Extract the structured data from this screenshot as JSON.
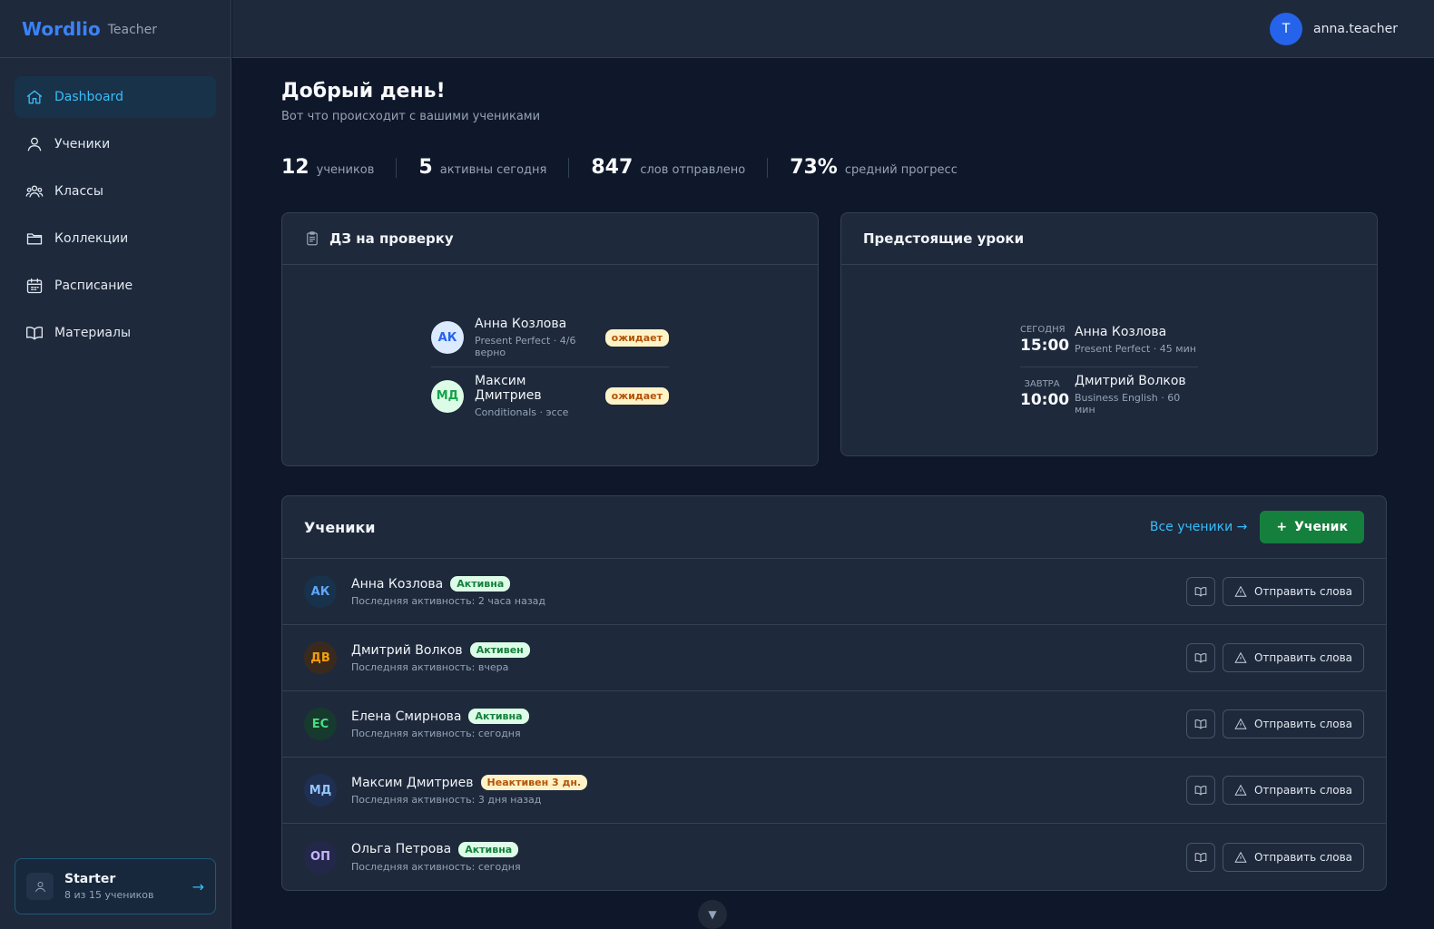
{
  "brand": {
    "name": "Wordlio",
    "role": "Teacher"
  },
  "nav": [
    {
      "label": "Dashboard",
      "icon": "home-icon"
    },
    {
      "label": "Ученики",
      "icon": "user-icon"
    },
    {
      "label": "Классы",
      "icon": "users-icon"
    },
    {
      "label": "Коллекции",
      "icon": "folder-icon"
    },
    {
      "label": "Расписание",
      "icon": "calendar-icon"
    },
    {
      "label": "Материалы",
      "icon": "book-icon"
    }
  ],
  "plan": {
    "title": "Starter",
    "sub": "8 из 15 учеников",
    "arrow": "→"
  },
  "user": {
    "initial": "T",
    "name": "anna.teacher"
  },
  "header": {
    "greeting": "Добрый день!",
    "subtitle": "Вот что происходит с вашими учениками"
  },
  "stats": [
    {
      "value": "12",
      "label": "учеников"
    },
    {
      "value": "5",
      "label": "активны сегодня"
    },
    {
      "value": "847",
      "label": "слов отправлено"
    },
    {
      "value": "73%",
      "label": "средний прогресс"
    }
  ],
  "homework": {
    "title": "ДЗ на проверку",
    "items": [
      {
        "initials": "АК",
        "name": "Анна Козлова",
        "meta": "Present Perfect · 4/6 верно",
        "badge": "ожидает"
      },
      {
        "initials": "МД",
        "name": "Максим Дмитриев",
        "meta": "Conditionals · эссе",
        "badge": "ожидает"
      }
    ]
  },
  "lessons": {
    "title": "Предстоящие уроки",
    "items": [
      {
        "day": "СЕГОДНЯ",
        "time": "15:00",
        "name": "Анна Козлова",
        "meta": "Present Perfect · 45 мин"
      },
      {
        "day": "ЗАВТРА",
        "time": "10:00",
        "name": "Дмитрий Волков",
        "meta": "Business English · 60 мин"
      }
    ]
  },
  "students": {
    "title": "Ученики",
    "all_link": "Все ученики →",
    "add_label": "Ученик",
    "send_label": "Отправить слова",
    "rows": [
      {
        "initials": "АК",
        "name": "Анна Козлова",
        "status": "Активна",
        "active": true,
        "last": "Последняя активность: 2 часа назад",
        "bg": "#17324a",
        "fg": "#60a5fa"
      },
      {
        "initials": "ДВ",
        "name": "Дмитрий Волков",
        "status": "Активен",
        "active": true,
        "last": "Последняя активность: вчера",
        "bg": "#3a2a1e",
        "fg": "#f59e0b"
      },
      {
        "initials": "ЕС",
        "name": "Елена Смирнова",
        "status": "Активна",
        "active": true,
        "last": "Последняя активность: сегодня",
        "bg": "#163a2e",
        "fg": "#4ade80"
      },
      {
        "initials": "МД",
        "name": "Максим Дмитриев",
        "status": "Неактивен 3 дн.",
        "active": false,
        "last": "Последняя активность: 3 дня назад",
        "bg": "#1e2f52",
        "fg": "#93c5fd"
      },
      {
        "initials": "ОП",
        "name": "Ольга Петрова",
        "status": "Активна",
        "active": true,
        "last": "Последняя активность: сегодня",
        "bg": "#23284a",
        "fg": "#c4b5fd"
      }
    ]
  },
  "colors": {
    "accent": "#3b82f6",
    "success": "#15803d",
    "link": "#38bdf8"
  }
}
